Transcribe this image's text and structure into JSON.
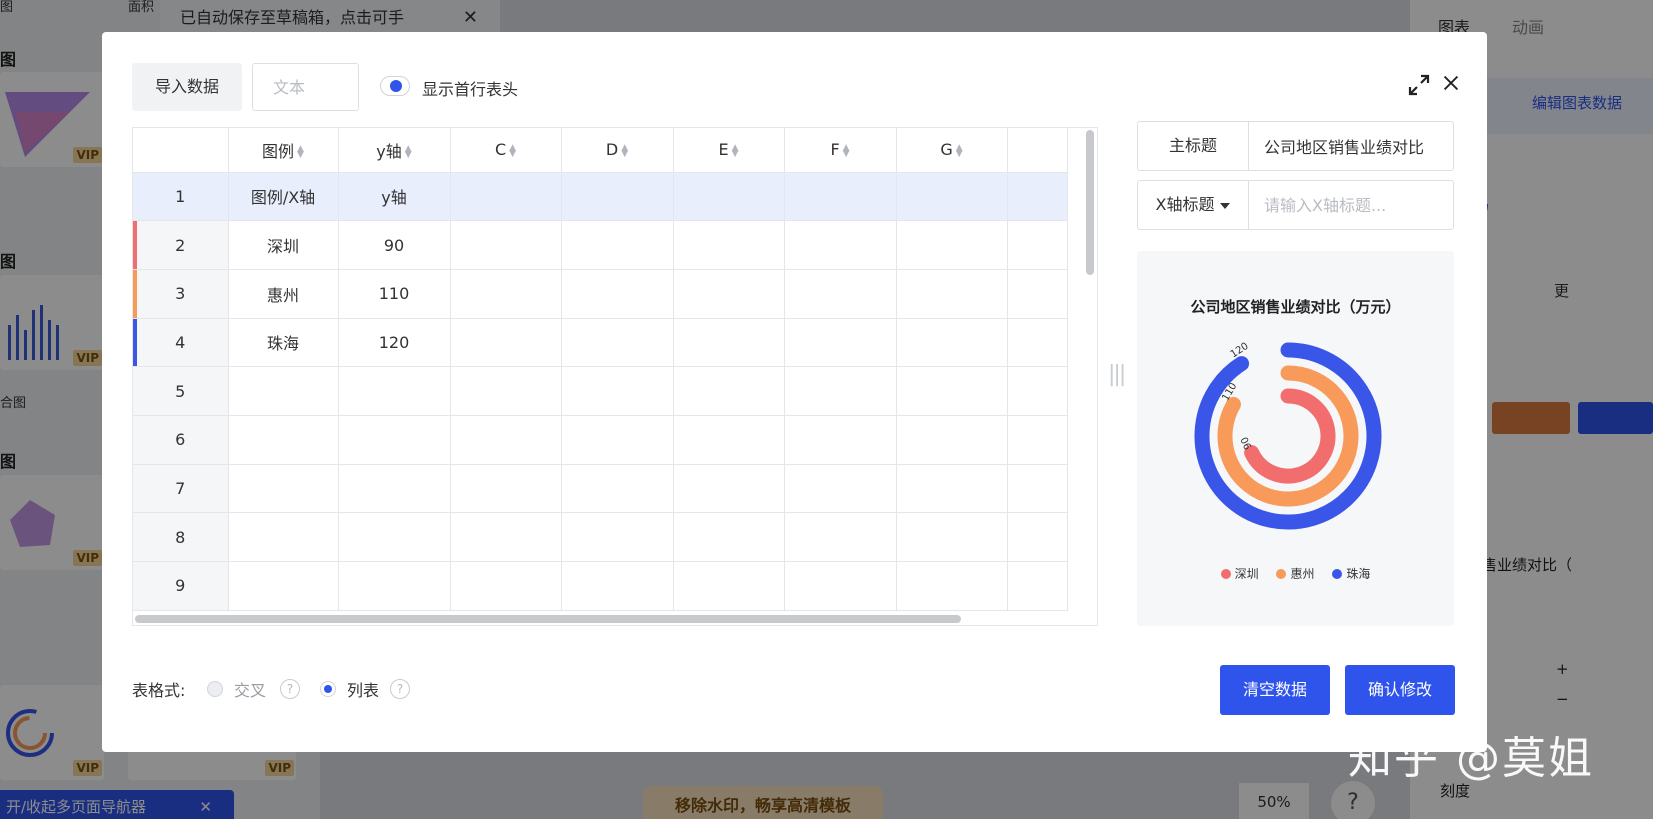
{
  "background": {
    "toast_text": "已自动保存至草稿箱，点击可手",
    "toast_close": "✕",
    "left_top_labels": [
      "图",
      "面积"
    ],
    "categories": [
      "图",
      "图",
      "图"
    ],
    "combo_label": "合图",
    "vip": "VIP",
    "nav_button": "开/收起多页面导航器",
    "nav_close": "✕",
    "watermark_button": "移除水印，畅享高清模板",
    "zoom": "50%",
    "help": "?",
    "right_tabs": [
      "图表",
      "动画"
    ],
    "edit_chart_data": "编辑图表数据",
    "more": "更",
    "right_title_text": "司地区销售业绩对比（",
    "scale_label": "刻度",
    "plus": "+",
    "minus": "−"
  },
  "modal": {
    "import_button": "导入数据",
    "text_placeholder": "文本",
    "show_header_label": "显示首行表头",
    "show_header_on": true,
    "table": {
      "columns": [
        "",
        "图例",
        "y轴",
        "C",
        "D",
        "E",
        "F",
        "G"
      ],
      "rows": [
        {
          "num": "1",
          "cells": [
            "图例/X轴",
            "y轴"
          ],
          "mark": ""
        },
        {
          "num": "2",
          "cells": [
            "深圳",
            "90"
          ],
          "mark": "#f26d6d"
        },
        {
          "num": "3",
          "cells": [
            "惠州",
            "110"
          ],
          "mark": "#f79a5a"
        },
        {
          "num": "4",
          "cells": [
            "珠海",
            "120"
          ],
          "mark": "#3a56e8"
        },
        {
          "num": "5",
          "cells": [
            "",
            ""
          ],
          "mark": ""
        },
        {
          "num": "6",
          "cells": [
            "",
            ""
          ],
          "mark": ""
        },
        {
          "num": "7",
          "cells": [
            "",
            ""
          ],
          "mark": ""
        },
        {
          "num": "8",
          "cells": [
            "",
            ""
          ],
          "mark": ""
        },
        {
          "num": "9",
          "cells": [
            "",
            ""
          ],
          "mark": ""
        }
      ]
    },
    "main_title_label": "主标题",
    "main_title_value": "公司地区销售业绩对比",
    "x_title_label": "X轴标题",
    "x_title_placeholder": "请输入X轴标题...",
    "table_format_label": "表格式:",
    "format_options": [
      {
        "label": "交叉",
        "selected": false,
        "help": "?"
      },
      {
        "label": "列表",
        "selected": true,
        "help": "?"
      }
    ],
    "clear_button": "清空数据",
    "confirm_button": "确认修改"
  },
  "chart_data": {
    "type": "radial-bar",
    "title": "公司地区销售业绩对比（万元）",
    "categories": [
      "深圳",
      "惠州",
      "珠海"
    ],
    "values": [
      90,
      110,
      120
    ],
    "colors": [
      "#f26d6d",
      "#f79a5a",
      "#3a56e8"
    ],
    "legend_position": "bottom"
  },
  "watermark": "知乎 @莫姐",
  "colors": {
    "accent": "#2f54eb"
  }
}
